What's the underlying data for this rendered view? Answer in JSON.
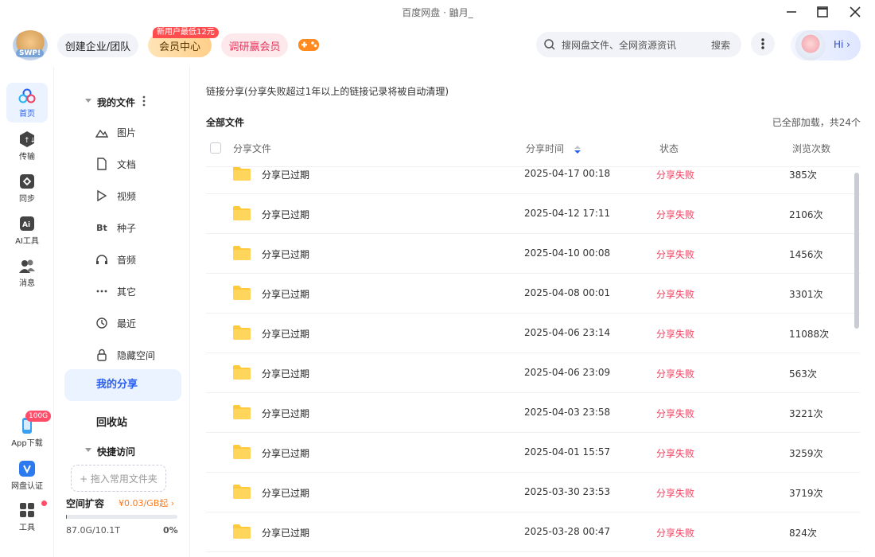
{
  "window": {
    "title": "百度网盘 · 鼬月_"
  },
  "header": {
    "logo_badge": "SWP!",
    "team_label": "创建企业/团队",
    "vip_tag": "新用户最低12元",
    "vip_label": "会员中心",
    "survey_label": "调研赢会员",
    "search_placeholder": "搜网盘文件、全网资源资讯",
    "search_button": "搜索",
    "greeting": "Hi"
  },
  "rail": [
    {
      "label": "首页",
      "icon": "home-cloud-icon",
      "active": true
    },
    {
      "label": "传输",
      "icon": "transfer-icon",
      "active": false
    },
    {
      "label": "同步",
      "icon": "sync-icon",
      "active": false
    },
    {
      "label": "AI工具",
      "icon": "ai-icon",
      "active": false
    },
    {
      "label": "消息",
      "icon": "message-icon",
      "active": false
    }
  ],
  "rail_bottom": [
    {
      "label": "App下载",
      "icon": "phone-icon"
    },
    {
      "label": "网盘认证",
      "icon": "verify-icon"
    },
    {
      "label": "工具",
      "icon": "tools-icon"
    }
  ],
  "rail_badge": "100G",
  "sidebar": {
    "my_files": "我的文件",
    "items": [
      {
        "label": "图片",
        "icon": "image-icon"
      },
      {
        "label": "文档",
        "icon": "document-icon"
      },
      {
        "label": "视频",
        "icon": "video-icon"
      },
      {
        "label": "种子",
        "icon": "torrent-icon"
      },
      {
        "label": "音频",
        "icon": "audio-icon"
      },
      {
        "label": "其它",
        "icon": "more-icon"
      },
      {
        "label": "最近",
        "icon": "recent-icon"
      },
      {
        "label": "隐藏空间",
        "icon": "lock-icon"
      }
    ],
    "my_share": "我的分享",
    "recycle": "回收站",
    "quick_access": "快捷访问",
    "drop_hint": "+ 拖入常用文件夹",
    "expand_title": "空间扩容",
    "expand_price": "¥0.03/GB起",
    "used": "87.0G/10.1T",
    "used_percent": "0%",
    "used_fraction": 0.0086
  },
  "main": {
    "notice": "链接分享(分享失败超过1年以上的链接记录将被自动清理)",
    "breadcrumb": "全部文件",
    "loaded_text": "已全部加载，共24个",
    "columns": {
      "file": "分享文件",
      "time": "分享时间",
      "status": "状态",
      "views": "浏览次数"
    },
    "rows": [
      {
        "name": "分享已过期",
        "time": "2025-04-17 00:18",
        "status": "分享失败",
        "views": "385次"
      },
      {
        "name": "分享已过期",
        "time": "2025-04-12 17:11",
        "status": "分享失败",
        "views": "2106次"
      },
      {
        "name": "分享已过期",
        "time": "2025-04-10 00:08",
        "status": "分享失败",
        "views": "1456次"
      },
      {
        "name": "分享已过期",
        "time": "2025-04-08 00:01",
        "status": "分享失败",
        "views": "3301次"
      },
      {
        "name": "分享已过期",
        "time": "2025-04-06 23:14",
        "status": "分享失败",
        "views": "11088次"
      },
      {
        "name": "分享已过期",
        "time": "2025-04-06 23:09",
        "status": "分享失败",
        "views": "563次"
      },
      {
        "name": "分享已过期",
        "time": "2025-04-03 23:58",
        "status": "分享失败",
        "views": "3221次"
      },
      {
        "name": "分享已过期",
        "time": "2025-04-01 15:57",
        "status": "分享失败",
        "views": "3259次"
      },
      {
        "name": "分享已过期",
        "time": "2025-03-30 23:53",
        "status": "分享失败",
        "views": "3719次"
      },
      {
        "name": "分享已过期",
        "time": "2025-03-28 00:47",
        "status": "分享失败",
        "views": "824次"
      }
    ]
  },
  "colors": {
    "accent": "#2b5ff0",
    "fail": "#f0405f",
    "folder": "#ffc93c"
  }
}
